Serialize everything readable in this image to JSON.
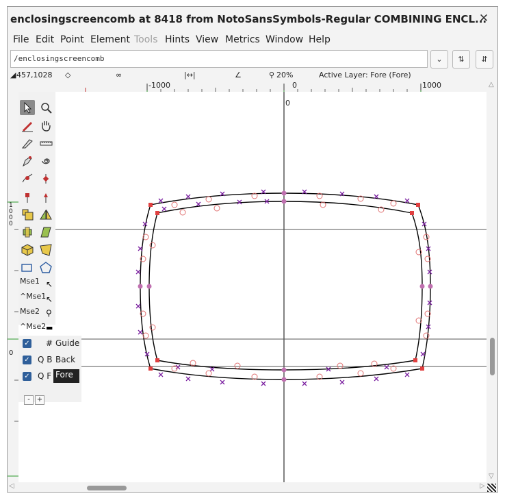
{
  "window": {
    "title": "enclosingscreencomb at 8418 from NotoSansSymbols-Regular COMBINING ENCL...",
    "close_glyph": "✕"
  },
  "menu": [
    {
      "label": "File",
      "enabled": true
    },
    {
      "label": "Edit",
      "enabled": true
    },
    {
      "label": "Point",
      "enabled": true
    },
    {
      "label": "Element",
      "enabled": true
    },
    {
      "label": "Tools",
      "enabled": false
    },
    {
      "label": "Hints",
      "enabled": true
    },
    {
      "label": "View",
      "enabled": true
    },
    {
      "label": "Metrics",
      "enabled": true
    },
    {
      "label": "Window",
      "enabled": true
    },
    {
      "label": "Help",
      "enabled": true
    }
  ],
  "glyph_path": "/enclosingscreencomb",
  "info": {
    "coords": "457,1028",
    "zoom": "20%",
    "active_layer": "Active Layer: Fore (Fore)"
  },
  "ruler": {
    "left_label": "-1000",
    "zero_label": "0",
    "right_label": "1000",
    "canvas_zero": "0",
    "vertical_top": "1000",
    "vertical_zero": "0"
  },
  "tools_text": {
    "mse1": "Mse1",
    "cmse1": "^Mse1",
    "mse2": "Mse2",
    "cmse2": "^Mse2"
  },
  "layers": [
    {
      "prefix": "#",
      "name": "Guide",
      "checked": true,
      "selected": false
    },
    {
      "prefix": "Q B",
      "name": "Back",
      "checked": true,
      "selected": false
    },
    {
      "prefix": "Q F",
      "name": "Fore",
      "checked": true,
      "selected": true
    }
  ],
  "layer_buttons": {
    "remove": "-",
    "add": "+"
  },
  "colors": {
    "outline": "#000000",
    "control_point": "#7a1fa0",
    "off_curve": "#e07070",
    "guide_green": "#2a9a2a"
  }
}
